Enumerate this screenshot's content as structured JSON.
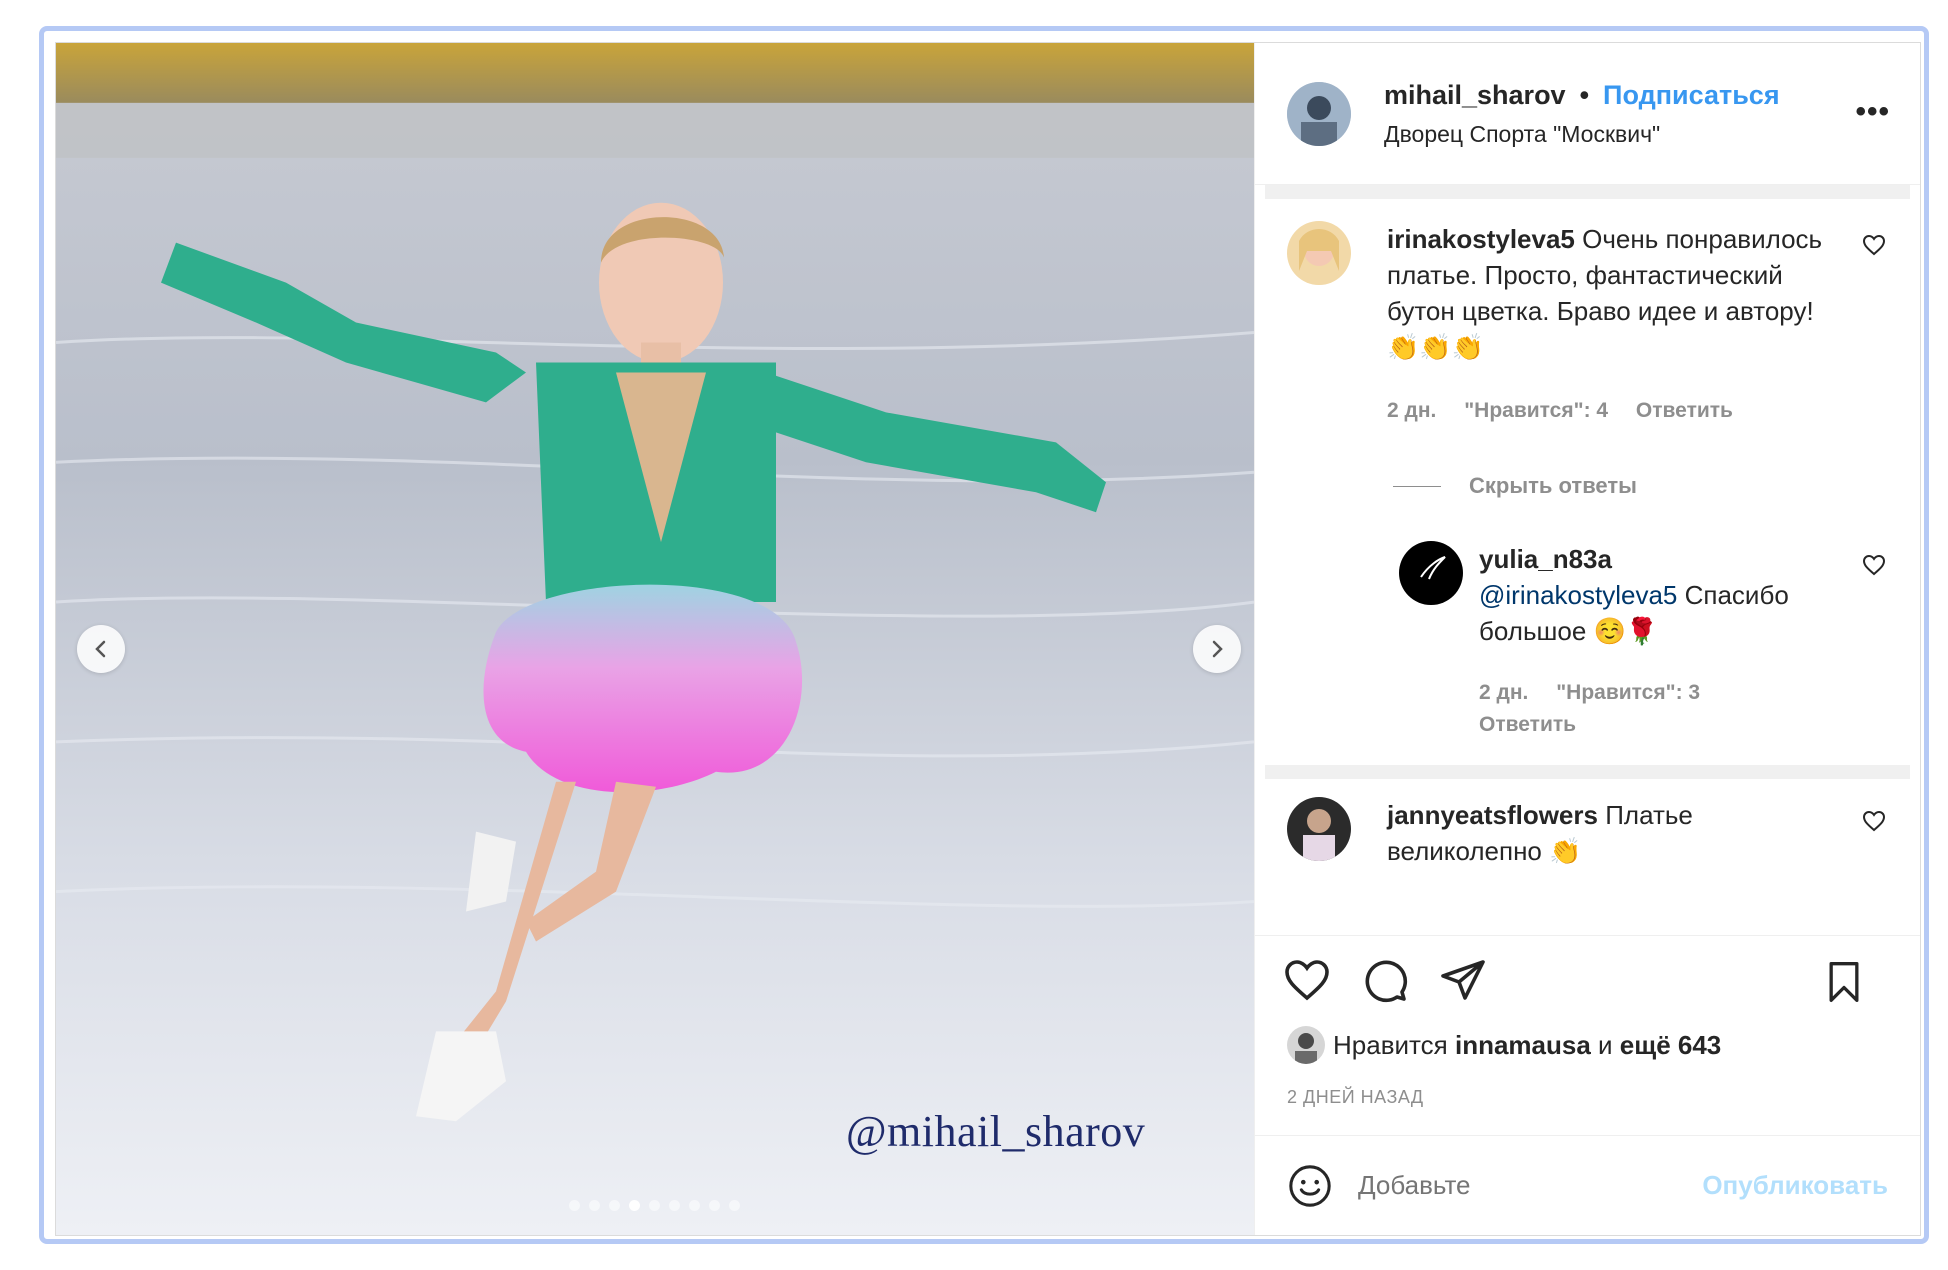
{
  "post": {
    "watermark": "@mihail_sharov",
    "carousel_total": 9,
    "carousel_active": 4
  },
  "header": {
    "username": "mihail_sharov",
    "separator": "•",
    "follow_label": "Подписаться",
    "location": "Дворец Спорта \"Москвич\"",
    "more_label": "•••"
  },
  "comments": [
    {
      "user": "irinakostyleva5",
      "text": "Очень понравилось платье. Просто, фантастический бутон цветка. Браво идее и автору! 👏👏👏",
      "time": "2 дн.",
      "likes": "\"Нравится\": 4",
      "reply": "Ответить"
    },
    {
      "user": "jannyeatsflowers",
      "text": "Платье великолепно 👏"
    }
  ],
  "hide_replies": "Скрыть ответы",
  "reply": {
    "user": "yulia_n83a",
    "mention": "@irinakostyleva5",
    "text": "Спасибо большое ☺️🌹",
    "time": "2 дн.",
    "likes": "\"Нравится\": 3",
    "reply": "Ответить"
  },
  "likes": {
    "prefix": "Нравится",
    "user": "innamausa",
    "middle": "и",
    "count": "ещё 643"
  },
  "time_ago": "2 ДНЕЙ НАЗАД",
  "composer": {
    "placeholder": "Добавьте",
    "publish": "Опубликовать"
  },
  "colors": {
    "accent": "#3897f0",
    "mention": "#00376b",
    "muted": "#8e8e8e",
    "frame": "#b5c9f5"
  }
}
